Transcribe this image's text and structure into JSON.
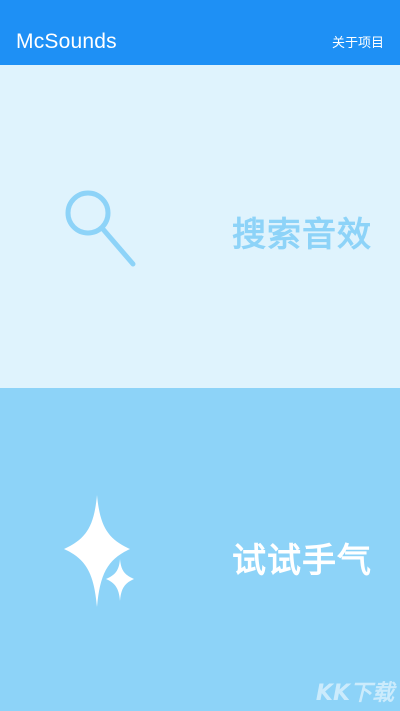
{
  "app_bar": {
    "title": "McSounds",
    "about_label": "关于项目"
  },
  "cards": {
    "search": {
      "label": "搜索音效",
      "icon": "search-icon"
    },
    "random": {
      "label": "试试手气",
      "icon": "sparkle-icon"
    }
  },
  "watermark": {
    "text": "KK下载"
  },
  "colors": {
    "primary": "#1e90f5",
    "search_card_bg": "#dff3fd",
    "random_card_bg": "#8dd3f8",
    "accent_text": "#8dd3f8",
    "on_primary": "#ffffff"
  }
}
